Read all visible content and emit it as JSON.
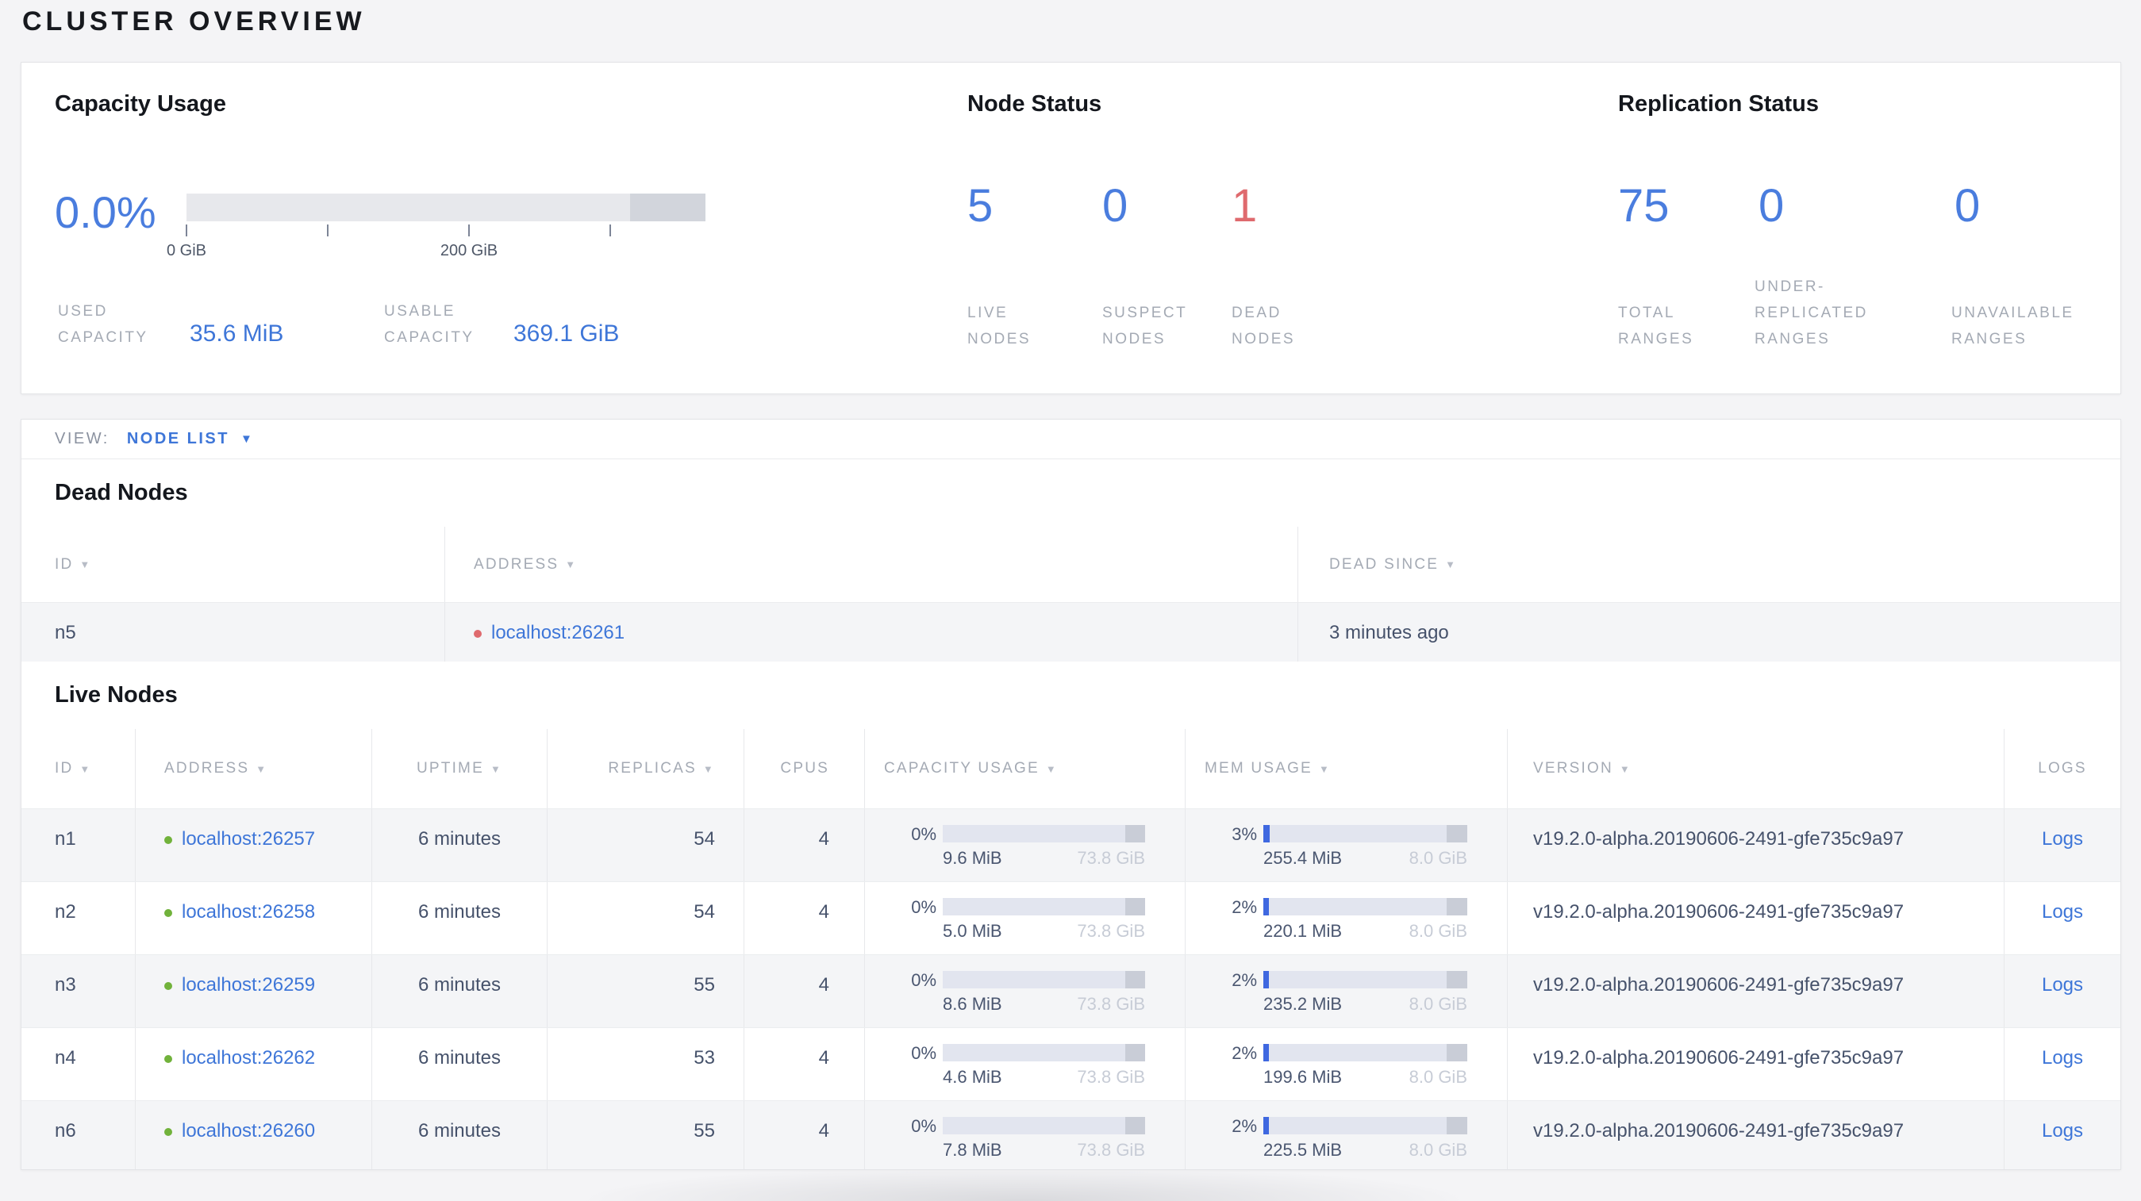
{
  "page_title": "CLUSTER OVERVIEW",
  "colors": {
    "accent_blue": "#3e76d8",
    "number_blue": "#4a7dde",
    "dead_red": "#df6a6e",
    "live_green": "#71b23b",
    "bar_fill_blue": "#3f68e0"
  },
  "summary": {
    "capacity": {
      "title": "Capacity Usage",
      "percent": "0.0%",
      "axis_ticks": {
        "0": "0 GiB",
        "2": "200 GiB"
      },
      "used_label": "USED CAPACITY",
      "used_value": "35.6 MiB",
      "usable_label": "USABLE CAPACITY",
      "usable_value": "369.1 GiB"
    },
    "node_status": {
      "title": "Node Status",
      "stats": [
        {
          "value": "5",
          "label": "LIVE NODES",
          "tone": "blue"
        },
        {
          "value": "0",
          "label": "SUSPECT NODES",
          "tone": "blue"
        },
        {
          "value": "1",
          "label": "DEAD NODES",
          "tone": "red"
        }
      ]
    },
    "replication": {
      "title": "Replication Status",
      "stats": [
        {
          "value": "75",
          "label": "TOTAL RANGES",
          "tone": "blue"
        },
        {
          "value": "0",
          "label": "UNDER-REPLICATED RANGES",
          "tone": "blue"
        },
        {
          "value": "0",
          "label": "UNAVAILABLE RANGES",
          "tone": "blue"
        }
      ]
    }
  },
  "view_bar": {
    "label": "VIEW:",
    "selected": "NODE LIST"
  },
  "dead_nodes": {
    "heading": "Dead Nodes",
    "columns": [
      {
        "label": "ID",
        "sortable": true
      },
      {
        "label": "ADDRESS",
        "sortable": true
      },
      {
        "label": "DEAD SINCE",
        "sortable": true
      }
    ],
    "rows": [
      {
        "id": "n5",
        "address": "localhost:26261",
        "dead_since": "3 minutes ago"
      }
    ]
  },
  "live_nodes": {
    "heading": "Live Nodes",
    "columns": [
      {
        "label": "ID",
        "sortable": true
      },
      {
        "label": "ADDRESS",
        "sortable": true
      },
      {
        "label": "UPTIME",
        "sortable": true
      },
      {
        "label": "REPLICAS",
        "sortable": true
      },
      {
        "label": "CPUS",
        "sortable": false
      },
      {
        "label": "CAPACITY USAGE",
        "sortable": true
      },
      {
        "label": "MEM USAGE",
        "sortable": true
      },
      {
        "label": "VERSION",
        "sortable": true
      },
      {
        "label": "LOGS",
        "sortable": false
      }
    ],
    "rows": [
      {
        "id": "n1",
        "address": "localhost:26257",
        "uptime": "6 minutes",
        "replicas": "54",
        "cpus": "4",
        "capacity_percent": "0%",
        "capacity_fill": 0,
        "capacity_used": "9.6 MiB",
        "capacity_total": "73.8 GiB",
        "mem_percent": "3%",
        "mem_fill": 3,
        "mem_used": "255.4 MiB",
        "mem_total": "8.0 GiB",
        "version": "v19.2.0-alpha.20190606-2491-gfe735c9a97",
        "logs": "Logs"
      },
      {
        "id": "n2",
        "address": "localhost:26258",
        "uptime": "6 minutes",
        "replicas": "54",
        "cpus": "4",
        "capacity_percent": "0%",
        "capacity_fill": 0,
        "capacity_used": "5.0 MiB",
        "capacity_total": "73.8 GiB",
        "mem_percent": "2%",
        "mem_fill": 2.6,
        "mem_used": "220.1 MiB",
        "mem_total": "8.0 GiB",
        "version": "v19.2.0-alpha.20190606-2491-gfe735c9a97",
        "logs": "Logs"
      },
      {
        "id": "n3",
        "address": "localhost:26259",
        "uptime": "6 minutes",
        "replicas": "55",
        "cpus": "4",
        "capacity_percent": "0%",
        "capacity_fill": 0,
        "capacity_used": "8.6 MiB",
        "capacity_total": "73.8 GiB",
        "mem_percent": "2%",
        "mem_fill": 2.6,
        "mem_used": "235.2 MiB",
        "mem_total": "8.0 GiB",
        "version": "v19.2.0-alpha.20190606-2491-gfe735c9a97",
        "logs": "Logs"
      },
      {
        "id": "n4",
        "address": "localhost:26262",
        "uptime": "6 minutes",
        "replicas": "53",
        "cpus": "4",
        "capacity_percent": "0%",
        "capacity_fill": 0,
        "capacity_used": "4.6 MiB",
        "capacity_total": "73.8 GiB",
        "mem_percent": "2%",
        "mem_fill": 2.6,
        "mem_used": "199.6 MiB",
        "mem_total": "8.0 GiB",
        "version": "v19.2.0-alpha.20190606-2491-gfe735c9a97",
        "logs": "Logs"
      },
      {
        "id": "n6",
        "address": "localhost:26260",
        "uptime": "6 minutes",
        "replicas": "55",
        "cpus": "4",
        "capacity_percent": "0%",
        "capacity_fill": 0,
        "capacity_used": "7.8 MiB",
        "capacity_total": "73.8 GiB",
        "mem_percent": "2%",
        "mem_fill": 2.6,
        "mem_used": "225.5 MiB",
        "mem_total": "8.0 GiB",
        "version": "v19.2.0-alpha.20190606-2491-gfe735c9a97",
        "logs": "Logs"
      }
    ]
  }
}
